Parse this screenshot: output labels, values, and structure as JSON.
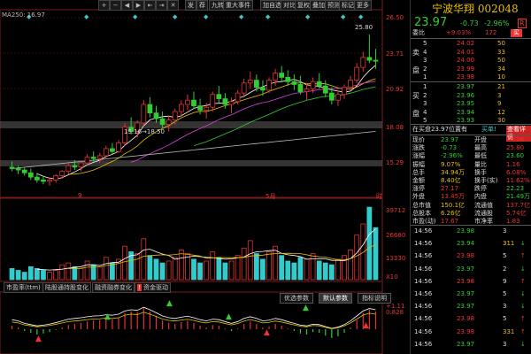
{
  "toolbar": {
    "buttons": [
      "发",
      "荐",
      "九转",
      "重大事件",
      "加自选",
      "对比",
      "复权",
      "叠加",
      "预测",
      "标记",
      "更多"
    ],
    "icons": [
      "+",
      "−",
      "◀",
      "▶",
      "⇤",
      "⇥",
      "✕"
    ]
  },
  "ma_label": "MA250: 16.97",
  "price_axis": [
    "26.50",
    "23.71",
    "20.92",
    "18.08",
    "15.29"
  ],
  "price_markers": {
    "high": "25.80",
    "low": "15.16→18.50"
  },
  "time_axis": [
    "9",
    "5月",
    "时"
  ],
  "volume_axis": [
    "39712",
    "26680",
    "13330",
    "X10"
  ],
  "indicator_tabs": [
    "市盈率(ttm)",
    "陆股通持股变化",
    "融资融券变化",
    "资金驱动"
  ],
  "indicator_buttons": [
    "优选参数",
    "默认参数",
    "指标说明"
  ],
  "macd_axis": [
    "+1.11",
    "0.828"
  ],
  "chart_data": {
    "type": "candlestick",
    "title": "",
    "xlabel": "",
    "ylabel": "",
    "ylim": [
      15.0,
      26.8
    ],
    "candles": [
      [
        16.5,
        16.9,
        16.2,
        16.4
      ],
      [
        16.4,
        16.6,
        16.0,
        16.3
      ],
      [
        16.3,
        16.5,
        15.9,
        16.1
      ],
      [
        16.1,
        16.4,
        15.6,
        15.8
      ],
      [
        15.8,
        16.1,
        15.4,
        15.6
      ],
      [
        15.6,
        15.9,
        15.3,
        15.5
      ],
      [
        15.5,
        15.8,
        15.2,
        15.6
      ],
      [
        15.6,
        16.0,
        15.4,
        15.9
      ],
      [
        15.9,
        16.3,
        15.7,
        16.2
      ],
      [
        16.2,
        16.8,
        16.0,
        16.6
      ],
      [
        16.6,
        17.0,
        16.3,
        16.5
      ],
      [
        16.5,
        16.9,
        16.2,
        16.8
      ],
      [
        16.8,
        17.4,
        16.6,
        17.2
      ],
      [
        17.2,
        17.6,
        16.9,
        17.1
      ],
      [
        17.1,
        17.5,
        16.8,
        17.3
      ],
      [
        17.3,
        18.0,
        17.1,
        17.8
      ],
      [
        17.8,
        18.2,
        17.4,
        17.6
      ],
      [
        17.6,
        18.4,
        17.5,
        18.2
      ],
      [
        18.2,
        19.6,
        18.0,
        19.3
      ],
      [
        19.3,
        20.0,
        18.8,
        19.0
      ],
      [
        19.0,
        19.8,
        18.6,
        19.6
      ],
      [
        19.6,
        21.2,
        19.4,
        20.9
      ],
      [
        20.9,
        21.4,
        20.0,
        20.3
      ],
      [
        20.3,
        20.8,
        19.6,
        19.9
      ],
      [
        19.9,
        20.4,
        19.2,
        19.5
      ],
      [
        19.5,
        20.1,
        19.0,
        19.8
      ],
      [
        19.8,
        20.6,
        19.5,
        20.4
      ],
      [
        20.4,
        21.2,
        20.1,
        20.9
      ],
      [
        20.9,
        21.6,
        20.5,
        21.2
      ],
      [
        21.2,
        21.8,
        20.6,
        20.8
      ],
      [
        20.8,
        21.3,
        20.2,
        20.5
      ],
      [
        20.5,
        21.0,
        19.9,
        20.7
      ],
      [
        20.7,
        21.8,
        20.4,
        21.6
      ],
      [
        21.6,
        22.2,
        21.0,
        21.3
      ],
      [
        21.3,
        21.7,
        20.6,
        20.9
      ],
      [
        20.9,
        21.4,
        20.3,
        21.1
      ],
      [
        21.1,
        21.9,
        20.9,
        21.7
      ],
      [
        21.7,
        22.7,
        21.4,
        22.4
      ],
      [
        22.4,
        23.2,
        22.0,
        22.6
      ],
      [
        22.6,
        23.0,
        21.8,
        22.1
      ],
      [
        22.1,
        22.6,
        21.5,
        21.9
      ],
      [
        21.9,
        22.8,
        21.7,
        22.6
      ],
      [
        22.6,
        23.4,
        22.2,
        23.1
      ],
      [
        23.1,
        23.6,
        22.5,
        22.8
      ],
      [
        22.8,
        23.3,
        22.2,
        22.5
      ],
      [
        22.5,
        23.0,
        21.9,
        22.3
      ],
      [
        22.3,
        22.9,
        21.6,
        21.8
      ],
      [
        21.8,
        22.4,
        21.2,
        22.0
      ],
      [
        22.0,
        22.8,
        21.7,
        22.5
      ],
      [
        22.5,
        23.1,
        22.0,
        22.2
      ],
      [
        22.2,
        22.6,
        21.4,
        21.7
      ],
      [
        21.7,
        22.1,
        20.9,
        21.2
      ],
      [
        21.2,
        21.9,
        20.8,
        21.6
      ],
      [
        21.6,
        22.3,
        21.3,
        22.1
      ],
      [
        22.1,
        22.9,
        21.9,
        22.6
      ],
      [
        22.6,
        23.8,
        22.4,
        23.5
      ],
      [
        23.5,
        24.6,
        23.2,
        24.2
      ],
      [
        24.2,
        25.8,
        23.8,
        24.0
      ],
      [
        24.0,
        24.8,
        23.4,
        23.97
      ]
    ],
    "volume": [
      6,
      5,
      4,
      7,
      6,
      5,
      4,
      5,
      8,
      9,
      7,
      6,
      10,
      8,
      7,
      12,
      9,
      11,
      18,
      15,
      14,
      22,
      13,
      11,
      9,
      10,
      12,
      16,
      14,
      11,
      9,
      10,
      15,
      12,
      9,
      10,
      13,
      17,
      21,
      14,
      11,
      15,
      18,
      13,
      10,
      9,
      12,
      11,
      14,
      10,
      9,
      8,
      11,
      13,
      16,
      24,
      30,
      39,
      28
    ],
    "macd": [
      0.1,
      0.05,
      -0.05,
      -0.1,
      -0.15,
      -0.12,
      -0.08,
      -0.02,
      0.05,
      0.12,
      0.15,
      0.18,
      0.22,
      0.25,
      0.26,
      0.3,
      0.28,
      0.32,
      0.45,
      0.5,
      0.48,
      0.6,
      0.5,
      0.38,
      0.25,
      0.18,
      0.15,
      0.2,
      0.24,
      0.18,
      0.1,
      0.05,
      0.12,
      0.1,
      0.02,
      -0.05,
      0.02,
      0.15,
      0.22,
      0.15,
      0.05,
      0.08,
      0.15,
      0.1,
      0.02,
      -0.05,
      -0.12,
      -0.15,
      -0.08,
      -0.1,
      -0.18,
      -0.25,
      -0.2,
      -0.1,
      0.05,
      0.25,
      0.45,
      0.55,
      0.5
    ]
  },
  "right_panel": {
    "name": "宁波华翔",
    "code": "002048",
    "price": "23.97",
    "change": "-0.73",
    "change_pct": "-2.96%",
    "flag": "R",
    "weibi": {
      "label": "委比",
      "value": "+9.03%",
      "extra": "172",
      "btn": "买"
    },
    "sell": [
      {
        "label": "5",
        "price": "24.02",
        "vol": "50"
      },
      {
        "label": "4",
        "price": "24.01",
        "vol": "33"
      },
      {
        "label": "3",
        "price": "24.00",
        "vol": "50"
      },
      {
        "label": "2",
        "price": "23.99",
        "vol": "34"
      },
      {
        "label": "1",
        "price": "23.98",
        "vol": "10"
      }
    ],
    "sell_side_label": [
      "卖",
      "盘"
    ],
    "buy": [
      {
        "label": "1",
        "price": "23.97",
        "vol": "21"
      },
      {
        "label": "2",
        "price": "23.96",
        "vol": "3"
      },
      {
        "label": "3",
        "price": "23.95",
        "vol": "9"
      },
      {
        "label": "4",
        "price": "23.94",
        "vol": "12"
      },
      {
        "label": "5",
        "price": "23.93",
        "vol": "30"
      }
    ],
    "buy_side_label": [
      "买",
      "盘"
    ],
    "position_text": "在买盘23.97位置有",
    "position_tail": "买单!",
    "view_btn": "查看详情",
    "stats": [
      [
        "现价",
        "23.97",
        "开盘",
        "25.26"
      ],
      [
        "涨跌",
        "-0.73",
        "最高",
        "25.80"
      ],
      [
        "涨幅",
        "-2.96%",
        "最低",
        "23.60"
      ],
      [
        "振幅",
        "9.07%",
        "量比",
        "1.16"
      ],
      [
        "总手",
        "34.94万",
        "换手",
        "6.08%"
      ],
      [
        "金额",
        "8.40亿",
        "换手(实)",
        "11.62%"
      ],
      [
        "涨停",
        "27.17",
        "跌停",
        "22.23"
      ],
      [
        "外盘",
        "13.45万",
        "内盘",
        "21.49万"
      ],
      [
        "总市值",
        "150.1亿",
        "流通值",
        "137.7亿"
      ],
      [
        "总股本",
        "6.26亿",
        "流通股",
        "5.74亿"
      ],
      [
        "市盈(动)",
        "17.67",
        "市净率",
        "1.83"
      ]
    ],
    "ticks": [
      [
        "14:56",
        "23.98",
        "3",
        ""
      ],
      [
        "14:56",
        "23.94",
        "311",
        "↓"
      ],
      [
        "14:56",
        "23.98",
        "5",
        "↑"
      ],
      [
        "14:56",
        "23.97",
        "2",
        "↓"
      ],
      [
        "14:56",
        "23.98",
        "9",
        "↑"
      ],
      [
        "14:56",
        "23.97",
        "5",
        "↓"
      ],
      [
        "14:56",
        "23.97",
        "3",
        "↓"
      ],
      [
        "14:56",
        "23.98",
        "5",
        "↑"
      ],
      [
        "14:56",
        "23.98",
        "331",
        "↑"
      ],
      [
        "14:56",
        "23.97",
        "3",
        "↓"
      ]
    ]
  },
  "colors": {
    "up": "#e33333",
    "down": "#33cc33",
    "ma5": "#ffffff",
    "ma10": "#e8c000",
    "ma20": "#e040e0",
    "ma60": "#33cc33",
    "ma250": "#bbbbbb"
  }
}
